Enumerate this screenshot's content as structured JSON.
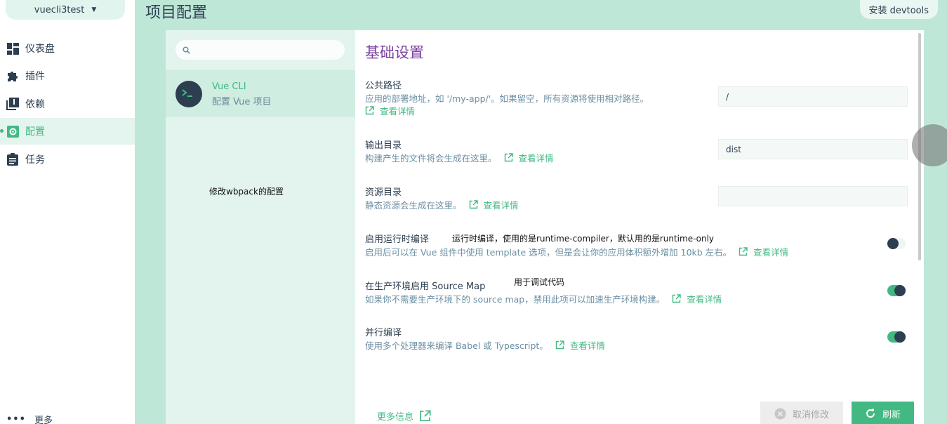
{
  "project_selector": {
    "name": "vuecli3test"
  },
  "nav": {
    "items": [
      {
        "label": "仪表盘",
        "icon": "dashboard-icon"
      },
      {
        "label": "插件",
        "icon": "puzzle-icon"
      },
      {
        "label": "依赖",
        "icon": "library-icon"
      },
      {
        "label": "配置",
        "icon": "settings-icon",
        "active": true
      },
      {
        "label": "任务",
        "icon": "clipboard-icon"
      }
    ],
    "more": "更多"
  },
  "header": {
    "title": "项目配置",
    "devtools_button": "安装 devtools"
  },
  "config_list": {
    "search_placeholder": "",
    "item": {
      "name": "Vue CLI",
      "description": "配置 Vue 项目"
    }
  },
  "annotations": {
    "webpack": "修改wbpack的配置",
    "runtime": "运行时编译，使用的是runtime-compiler，默认用的是runtime-only",
    "sourcemap": "用于调试代码"
  },
  "settings": {
    "section_title": "基础设置",
    "more_link": "查看详情",
    "items": [
      {
        "label": "公共路径",
        "desc": "应用的部署地址，如 '/my-app/'。如果留空，所有资源将使用相对路径。",
        "value": "/"
      },
      {
        "label": "输出目录",
        "desc": "构建产生的文件将会生成在这里。",
        "value": "dist"
      },
      {
        "label": "资源目录",
        "desc": "静态资源会生成在这里。",
        "value": ""
      },
      {
        "label": "启用运行时编译",
        "desc": "启用后可以在 Vue 组件中使用 template 选项，但是会让你的应用体积额外增加 10kb 左右。",
        "enabled": false
      },
      {
        "label": "在生产环境启用 Source Map",
        "desc": "如果你不需要生产环境下的 source map，禁用此项可以加速生产环境构建。",
        "enabled": true
      },
      {
        "label": "并行编译",
        "desc": "使用多个处理器来编译 Babel 或 Typescript。",
        "enabled": true
      }
    ]
  },
  "footer": {
    "more_info": "更多信息",
    "cancel_button": "取消修改",
    "refresh_button": "刷新"
  },
  "colors": {
    "accent": "#42b983",
    "dark": "#2c3e50",
    "title_purple": "#7b3fa0",
    "background_mint": "#bfe7d8"
  }
}
